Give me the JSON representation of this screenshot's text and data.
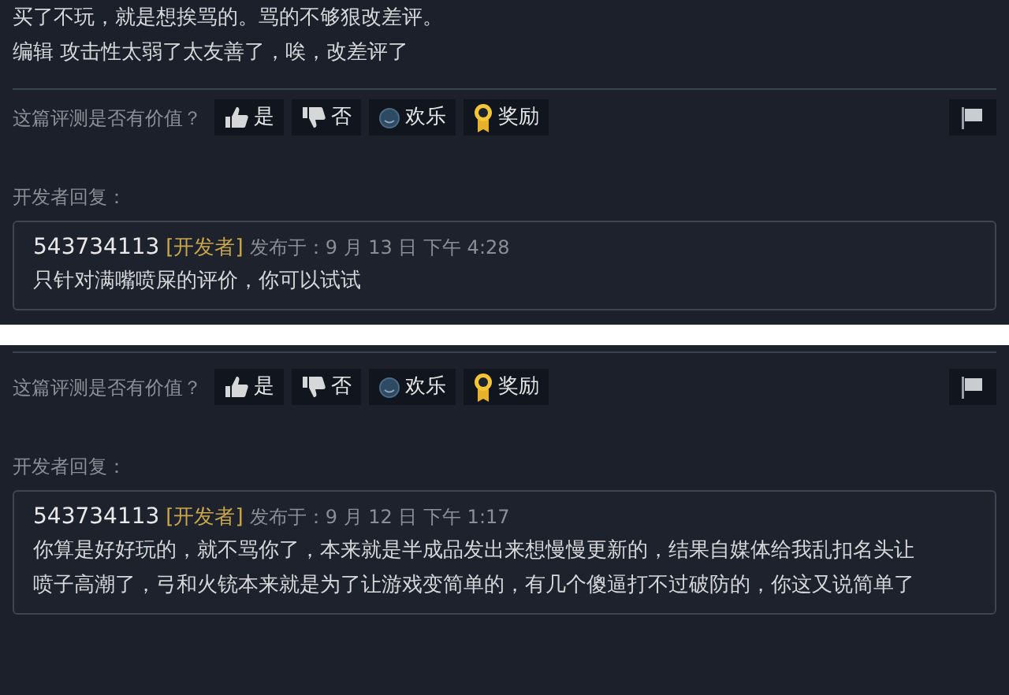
{
  "panels": [
    {
      "review_lines": [
        "买了不玩，就是想挨骂的。骂的不够狠改差评。",
        "编辑 攻击性太弱了太友善了，唉，改差评了"
      ],
      "vote_prompt": "这篇评测是否有价值？",
      "vote_buttons": [
        {
          "kind": "yes",
          "label": "是"
        },
        {
          "kind": "no",
          "label": "否"
        },
        {
          "kind": "funny",
          "label": "欢乐"
        },
        {
          "kind": "award",
          "label": "奖励"
        }
      ],
      "dev_reply_heading": "开发者回复：",
      "reply": {
        "author": "543734113",
        "badge": "[开发者]",
        "posted": "发布于：9 月 13 日 下午 4:28",
        "text": "只针对满嘴喷屎的评价，你可以试试"
      }
    },
    {
      "vote_prompt": "这篇评测是否有价值？",
      "vote_buttons": [
        {
          "kind": "yes",
          "label": "是"
        },
        {
          "kind": "no",
          "label": "否"
        },
        {
          "kind": "funny",
          "label": "欢乐"
        },
        {
          "kind": "award",
          "label": "奖励"
        }
      ],
      "dev_reply_heading": "开发者回复：",
      "reply": {
        "author": "543734113",
        "badge": "[开发者]",
        "posted": "发布于：9 月 12 日 下午 1:17",
        "text": "你算是好好玩的，就不骂你了，本来就是半成品发出来想慢慢更新的，结果自媒体给我乱扣名头让喷子高潮了，弓和火铳本来就是为了让游戏变简单的，有几个傻逼打不过破防的，你这又说简单了"
      }
    }
  ]
}
